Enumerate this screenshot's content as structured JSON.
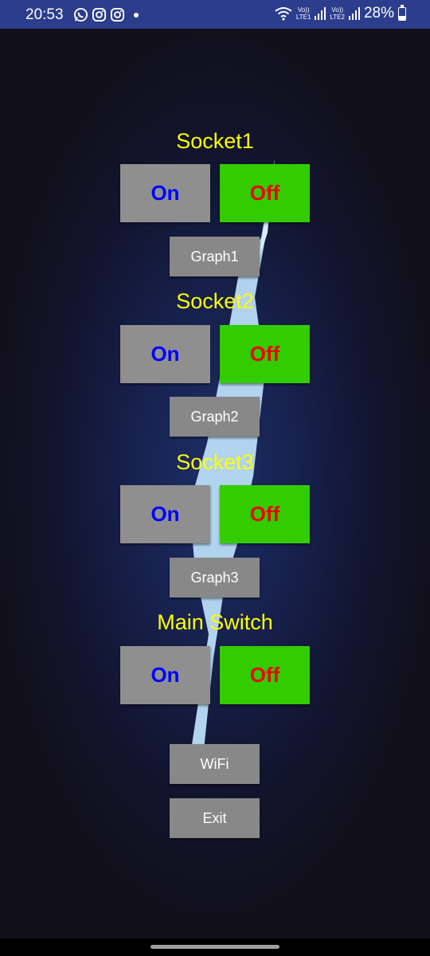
{
  "status_bar": {
    "time": "20:53",
    "left_icons": [
      "whatsapp-icon",
      "instagram-icon",
      "instagram-icon"
    ],
    "sim1_label_top": "Vo))",
    "sim1_label_bottom": "LTE1",
    "sim2_label_top": "Vo))",
    "sim2_label_bottom": "LTE2",
    "battery_percent": "28%",
    "battery_level": 0.28
  },
  "colors": {
    "status_bar_bg": "#2b3d8c",
    "title_yellow": "#ffff00",
    "on_text_blue": "#0000ff",
    "off_text_red": "#ee0000",
    "off_button_green": "#33cc00",
    "button_gray": "#8f8f8f",
    "bolt_light_blue": "#b9ddf7"
  },
  "sockets": [
    {
      "title": "Socket1",
      "on_label": "On",
      "off_label": "Off",
      "graph_label": "Graph1"
    },
    {
      "title": "Socket2",
      "on_label": "On",
      "off_label": "Off",
      "graph_label": "Graph2"
    },
    {
      "title": "Socket3",
      "on_label": "On",
      "off_label": "Off",
      "graph_label": "Graph3"
    }
  ],
  "main_switch": {
    "title": "Main Switch",
    "on_label": "On",
    "off_label": "Off"
  },
  "wifi_label": "WiFi",
  "exit_label": "Exit"
}
